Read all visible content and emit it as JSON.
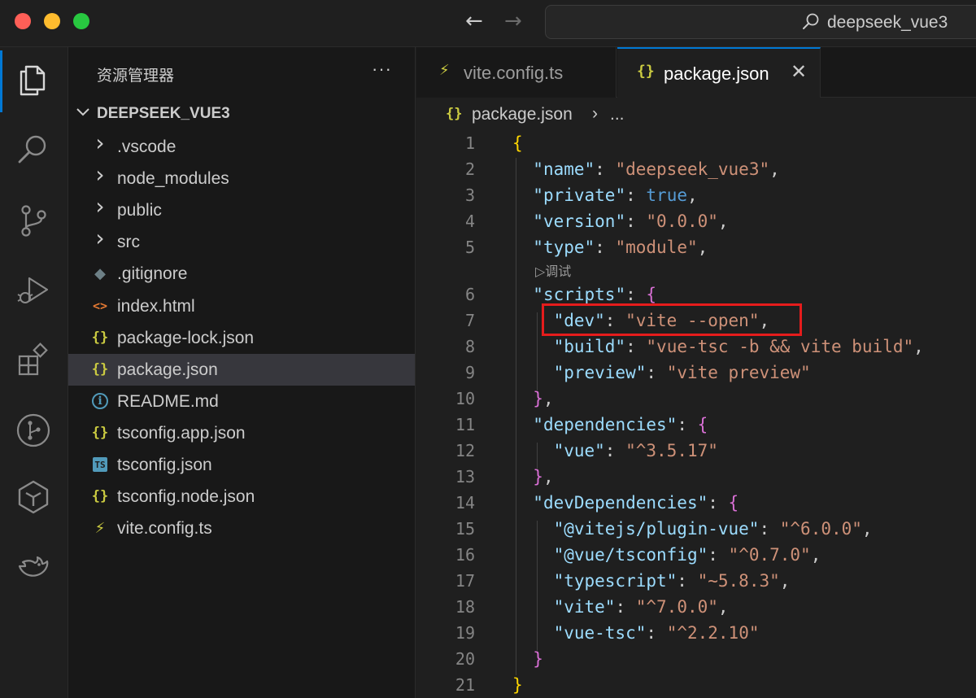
{
  "titlebar": {
    "search_text": "deepseek_vue3",
    "back_glyph": "←",
    "forward_glyph": "→"
  },
  "activity_bar": {
    "icons": [
      "files-icon",
      "search-icon",
      "source-control-icon",
      "run-debug-icon",
      "extensions-icon",
      "git-graph-icon",
      "tongyi-lingma-icon",
      "deepseek-icon"
    ]
  },
  "sidebar": {
    "title": "资源管理器",
    "more": "···",
    "project": "DEEPSEEK_VUE3",
    "items": [
      {
        "label": ".vscode",
        "icon": "chevron-right-icon",
        "glyph": "›"
      },
      {
        "label": "node_modules",
        "icon": "chevron-right-icon",
        "glyph": "›"
      },
      {
        "label": "public",
        "icon": "chevron-right-icon",
        "glyph": "›"
      },
      {
        "label": "src",
        "icon": "chevron-right-icon",
        "glyph": "›"
      },
      {
        "label": ".gitignore",
        "icon": "git-file-icon",
        "glyph": "◆"
      },
      {
        "label": "index.html",
        "icon": "html-file-icon",
        "glyph": "<>"
      },
      {
        "label": "package-lock.json",
        "icon": "json-file-icon",
        "glyph": "{}"
      },
      {
        "label": "package.json",
        "icon": "json-file-icon",
        "glyph": "{}",
        "selected": true
      },
      {
        "label": "README.md",
        "icon": "info-file-icon",
        "glyph": "i"
      },
      {
        "label": "tsconfig.app.json",
        "icon": "json-file-icon",
        "glyph": "{}"
      },
      {
        "label": "tsconfig.json",
        "icon": "ts-file-icon",
        "glyph": "TS"
      },
      {
        "label": "tsconfig.node.json",
        "icon": "json-file-icon",
        "glyph": "{}"
      },
      {
        "label": "vite.config.ts",
        "icon": "vite-file-icon",
        "glyph": "⚡"
      }
    ]
  },
  "tabs": [
    {
      "label": "vite.config.ts",
      "icon": "vite-file-icon",
      "glyph": "⚡",
      "active": false
    },
    {
      "label": "package.json",
      "icon": "json-file-icon",
      "glyph": "{}",
      "active": true,
      "close": "✕"
    }
  ],
  "breadcrumb": {
    "icon_glyph": "{}",
    "file": "package.json",
    "separator": "›",
    "more": "..."
  },
  "editor": {
    "codelens": "▷调试",
    "highlighted_line": 7,
    "lines": [
      {
        "n": "1",
        "code": "{"
      },
      {
        "n": "2",
        "code": "  \"name\": \"deepseek_vue3\","
      },
      {
        "n": "3",
        "code": "  \"private\": true,"
      },
      {
        "n": "4",
        "code": "  \"version\": \"0.0.0\","
      },
      {
        "n": "5",
        "code": "  \"type\": \"module\","
      },
      {
        "n": "6",
        "code": "  \"scripts\": {"
      },
      {
        "n": "7",
        "code": "    \"dev\": \"vite --open\","
      },
      {
        "n": "8",
        "code": "    \"build\": \"vue-tsc -b && vite build\","
      },
      {
        "n": "9",
        "code": "    \"preview\": \"vite preview\""
      },
      {
        "n": "10",
        "code": "  },"
      },
      {
        "n": "11",
        "code": "  \"dependencies\": {"
      },
      {
        "n": "12",
        "code": "    \"vue\": \"^3.5.17\""
      },
      {
        "n": "13",
        "code": "  },"
      },
      {
        "n": "14",
        "code": "  \"devDependencies\": {"
      },
      {
        "n": "15",
        "code": "    \"@vitejs/plugin-vue\": \"^6.0.0\","
      },
      {
        "n": "16",
        "code": "    \"@vue/tsconfig\": \"^0.7.0\","
      },
      {
        "n": "17",
        "code": "    \"typescript\": \"~5.8.3\","
      },
      {
        "n": "18",
        "code": "    \"vite\": \"^7.0.0\","
      },
      {
        "n": "19",
        "code": "    \"vue-tsc\": \"^2.2.10\""
      },
      {
        "n": "20",
        "code": "  }"
      },
      {
        "n": "21",
        "code": "}"
      }
    ]
  },
  "colors": {
    "json_icon": "#cbcb41",
    "html_icon": "#e37933",
    "ts_icon": "#519aba",
    "vite_icon": "#cbcb41",
    "git_icon": "#41535b",
    "info_icon": "#519aba",
    "accent": "#0078d4",
    "highlight_box": "#e51c1c"
  }
}
